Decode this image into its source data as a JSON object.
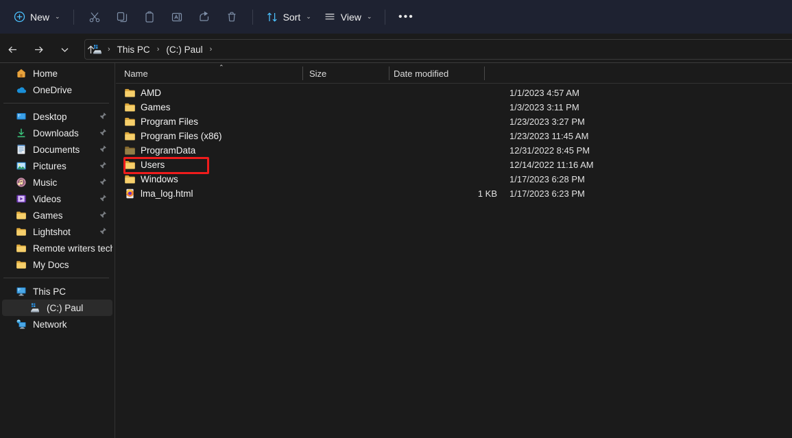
{
  "toolbar": {
    "new_label": "New",
    "sort_label": "Sort",
    "view_label": "View",
    "more_label": "•••",
    "icons": {
      "new": "circle-plus-icon",
      "cut": "scissors-icon",
      "copy": "copy-icon",
      "paste": "paste-icon",
      "rename": "rename-icon",
      "share": "share-icon",
      "delete": "trash-icon",
      "sort": "sort-arrows-icon",
      "view": "view-list-icon",
      "more": "more-options-icon"
    },
    "accent_color": "#4cc2ff",
    "background": "#1e2231"
  },
  "addressbar": {
    "back": "back-arrow-icon",
    "forward": "forward-arrow-icon",
    "recent": "chevron-down-icon",
    "up": "up-arrow-icon",
    "drive_icon": "local-disk-icon",
    "crumbs": [
      "This PC",
      "(C:) Paul"
    ],
    "separator": "›"
  },
  "sidebar": {
    "groups": [
      {
        "items": [
          {
            "label": "Home",
            "icon": "home-icon",
            "pinned": false,
            "indent": false,
            "selected": false
          },
          {
            "label": "OneDrive",
            "icon": "onedrive-cloud-icon",
            "pinned": false,
            "indent": false,
            "selected": false
          }
        ]
      },
      {
        "items": [
          {
            "label": "Desktop",
            "icon": "desktop-icon",
            "pinned": true,
            "indent": false,
            "selected": false
          },
          {
            "label": "Downloads",
            "icon": "downloads-icon",
            "pinned": true,
            "indent": false,
            "selected": false
          },
          {
            "label": "Documents",
            "icon": "documents-icon",
            "pinned": true,
            "indent": false,
            "selected": false
          },
          {
            "label": "Pictures",
            "icon": "pictures-icon",
            "pinned": true,
            "indent": false,
            "selected": false
          },
          {
            "label": "Music",
            "icon": "music-icon",
            "pinned": true,
            "indent": false,
            "selected": false
          },
          {
            "label": "Videos",
            "icon": "videos-icon",
            "pinned": true,
            "indent": false,
            "selected": false
          },
          {
            "label": "Games",
            "icon": "folder-icon",
            "pinned": true,
            "indent": false,
            "selected": false
          },
          {
            "label": "Lightshot",
            "icon": "folder-icon",
            "pinned": true,
            "indent": false,
            "selected": false
          },
          {
            "label": "Remote writers tech",
            "icon": "folder-icon",
            "pinned": false,
            "indent": false,
            "selected": false
          },
          {
            "label": "My Docs",
            "icon": "folder-icon",
            "pinned": false,
            "indent": false,
            "selected": false
          }
        ]
      },
      {
        "items": [
          {
            "label": "This PC",
            "icon": "this-pc-icon",
            "pinned": false,
            "indent": false,
            "selected": false
          },
          {
            "label": "(C:) Paul",
            "icon": "local-disk-icon",
            "pinned": false,
            "indent": true,
            "selected": true
          },
          {
            "label": "Network",
            "icon": "network-icon",
            "pinned": false,
            "indent": false,
            "selected": false
          }
        ]
      }
    ]
  },
  "filelist": {
    "columns": [
      {
        "key": "name",
        "label": "Name",
        "sorted": "ascending"
      },
      {
        "key": "size",
        "label": "Size",
        "sorted": null
      },
      {
        "key": "date",
        "label": "Date modified",
        "sorted": null
      }
    ],
    "rows": [
      {
        "name": "AMD",
        "size": "",
        "date": "1/1/2023 4:57 AM",
        "icon": "folder-icon",
        "dim": false,
        "highlighted": false
      },
      {
        "name": "Games",
        "size": "",
        "date": "1/3/2023 3:11 PM",
        "icon": "folder-icon",
        "dim": false,
        "highlighted": false
      },
      {
        "name": "Program Files",
        "size": "",
        "date": "1/23/2023 3:27 PM",
        "icon": "folder-icon",
        "dim": false,
        "highlighted": false
      },
      {
        "name": "Program Files (x86)",
        "size": "",
        "date": "1/23/2023 11:45 AM",
        "icon": "folder-icon",
        "dim": false,
        "highlighted": false
      },
      {
        "name": "ProgramData",
        "size": "",
        "date": "12/31/2022 8:45 PM",
        "icon": "folder-icon",
        "dim": true,
        "highlighted": false
      },
      {
        "name": "Users",
        "size": "",
        "date": "12/14/2022 11:16 AM",
        "icon": "folder-icon",
        "dim": false,
        "highlighted": true
      },
      {
        "name": "Windows",
        "size": "",
        "date": "1/17/2023 6:28 PM",
        "icon": "folder-icon",
        "dim": false,
        "highlighted": false
      },
      {
        "name": "lma_log.html",
        "size": "1 KB",
        "date": "1/17/2023 6:23 PM",
        "icon": "html-file-icon",
        "dim": false,
        "highlighted": false
      }
    ],
    "highlight_color": "#ef1c1c"
  }
}
